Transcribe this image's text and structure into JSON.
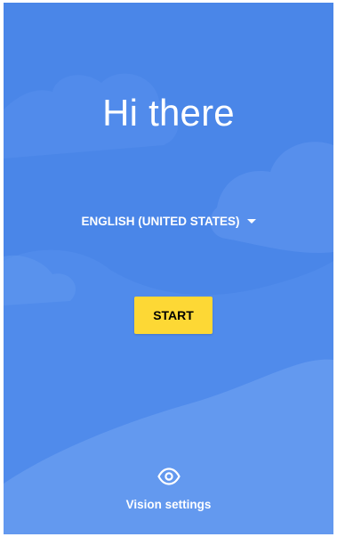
{
  "colors": {
    "background": "#4a86e8",
    "start_button": "#fdd835",
    "text": "#ffffff"
  },
  "welcome": {
    "title": "Hi there"
  },
  "language": {
    "selected": "ENGLISH (UNITED STATES)",
    "icon": "dropdown-caret-icon"
  },
  "start_button": {
    "label": "START"
  },
  "vision_settings": {
    "label": "Vision settings",
    "icon": "eye-icon"
  }
}
